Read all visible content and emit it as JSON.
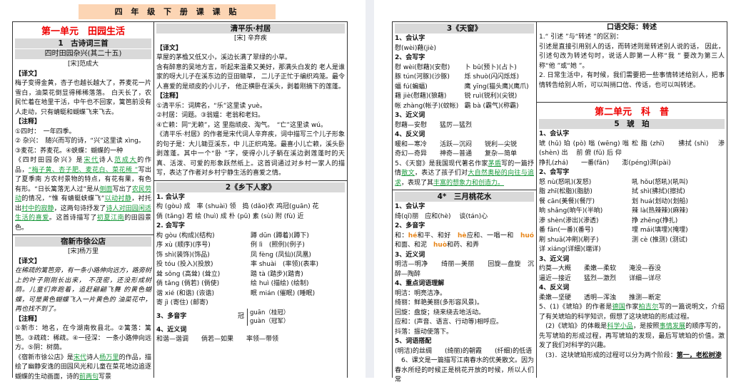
{
  "title": "四 年 级 下 册 课 课 贴",
  "pages": [
    {
      "cols": [
        {
          "cells": [
            {
              "items": [
                {
                  "type": "unit",
                  "text": "第一单元　田园生活"
                },
                {
                  "type": "hdr",
                  "text": "1　古诗词三首"
                },
                {
                  "type": "hdr2",
                  "text": "四时田园杂兴(其二十五)"
                },
                {
                  "type": "author",
                  "text": "[宋]范成大"
                },
                {
                  "type": "h",
                  "text": "【译文】"
                },
                {
                  "type": "p",
                  "text": "梅子变得金黄，杏子也越长越大了，荞麦花一片雪白，油菜花倒显得稀稀落落。 白天长了，农民忙着在地里干活，中午也不回家，篱笆前没有人走动，只有蜻蜓和蝴蝶飞来飞去。"
                },
                {
                  "type": "h",
                  "text": "【注释】"
                },
                {
                  "type": "p",
                  "text": "①四时：　一年四季。"
                },
                {
                  "type": "p",
                  "text": "② 杂兴：　随兴而写的诗，“兴”这里读 xìng。"
                },
                {
                  "type": "p",
                  "text": "③麦花：荞麦花。④蛱蝶：蝴蝶的一种"
                },
                {
                  "type": "p",
                  "segs": [
                    {
                      "t": "《四时田园杂兴》是"
                    },
                    {
                      "t": "宋代",
                      "c": "g"
                    },
                    {
                      "t": "诗人"
                    },
                    {
                      "t": "范成大",
                      "c": "g"
                    },
                    {
                      "t": "的作品，"
                    },
                    {
                      "t": "“梅子黄、杏子肥、麦花白、菜花稀 ”",
                      "c": "g"
                    },
                    {
                      "t": "写出了夏季南 方农村景物的特点，有花有果，有色有形。“日长篱落无人过”是从"
                    },
                    {
                      "t": "侧面",
                      "c": "g"
                    },
                    {
                      "t": "写出了"
                    },
                    {
                      "t": "农民劳动",
                      "c": "g"
                    },
                    {
                      "t": "的情况，“惟 有蜻蜓蛱蝶飞”"
                    },
                    {
                      "t": "以动衬静",
                      "c": "g"
                    },
                    {
                      "t": "，衬托出"
                    },
                    {
                      "t": "村中的寂静",
                      "c": "g"
                    },
                    {
                      "t": "，这两句诗抒发了"
                    },
                    {
                      "t": "诗人对田园闲适生活的喜爱",
                      "c": "g"
                    },
                    {
                      "t": "。这首诗描写了"
                    },
                    {
                      "t": "初夏江南",
                      "c": "g"
                    },
                    {
                      "t": "的田园景色。"
                    }
                  ]
                }
              ]
            },
            {
              "items": [
                {
                  "type": "hdr",
                  "text": "宿新市徐公店"
                },
                {
                  "type": "author",
                  "text": "[宋]杨万里"
                },
                {
                  "type": "h",
                  "text": "【译文】"
                },
                {
                  "type": "pi",
                  "text": "在稀疏的篱笆旁，有一条小路伸向远方，路旁树上的叶子刚刚长出来， 不茂密，还没形成树荫。儿童们奔跑着，追赶翩翩飞舞 的黄色蝴蝶，可是黄色蝴蝶飞入一片黄色的 油菜花中，再也找不到了。"
                },
                {
                  "type": "h",
                  "text": "【注释】"
                },
                {
                  "type": "p",
                  "text": "①新市：地名，在今湖南攸县北。②篱落：篱笆。③疏疏：稀疏。④一径深： 一条小路伸向远方。⑤阴：树荫。"
                },
                {
                  "type": "p",
                  "segs": [
                    {
                      "t": "《宿新市徐公店》是"
                    },
                    {
                      "t": "宋代",
                      "c": "g"
                    },
                    {
                      "t": "诗人"
                    },
                    {
                      "t": "杨万里",
                      "c": "g"
                    },
                    {
                      "t": "的作品，描绘了幽静安逸的田园风光和儿童在菜花地边追逐蝴蝶的生动画面，诗的"
                    },
                    {
                      "t": "前两句",
                      "c": "g"
                    },
                    {
                      "t": "写景"
                    }
                  ]
                }
              ]
            }
          ]
        },
        {
          "cells": [
            {
              "items": [
                {
                  "type": "hdr",
                  "text": "清平乐·村居"
                },
                {
                  "type": "author",
                  "text": "[宋] 辛弃疾"
                },
                {
                  "type": "h",
                  "text": "【译文】"
                },
                {
                  "type": "p",
                  "text": "草屋的茅檐又低又小，溪边长满了翠绿的小草。"
                },
                {
                  "type": "p",
                  "text": "含有醉意的吴地方言，听起来温柔又美好，那满头白发的 老人是谁家的呀大儿子在溪东边的豆田锄草， 二儿子正忙于编织鸡笼。最令人喜爱的是顽皮的小儿子， 他正横卧在溪头，剥着刚摘下的莲蓬。"
                },
                {
                  "type": "h",
                  "text": "【注释】"
                },
                {
                  "type": "p",
                  "text": "①清平乐：词牌名，“乐”这里读 yuè。"
                },
                {
                  "type": "p",
                  "text": "②村居：词题。③翁媪：老翁和老妇。"
                },
                {
                  "type": "p",
                  "text": "④亡赖：同“无赖”，这 里指顽皮、淘气。　“亡”这里读 wú。"
                },
                {
                  "type": "p",
                  "text": "《清平乐·村居》的作者是宋代词人辛弃疾，词中描写三个儿子形象的句子是：大儿锄豆溪东，中 儿正织鸡笼。最喜小儿亡赖，溪头卧剥莲蓬。其中一个“卧 ”字，使得小儿子躺在溪边剥莲蓬时的天 真、活泼、可爱的形象跃然纸上。这首词通过对乡村一家人的描写，表达了作者对乡村宁静生活的喜爱之情。"
                }
              ]
            },
            {
              "items": [
                {
                  "type": "hdr",
                  "text": "2《乡下人家》"
                },
                {
                  "type": "h",
                  "text": "1. 会认字"
                },
                {
                  "type": "p",
                  "text": "构 (gòu) 成　率 (shuài) 领　捣 (dǎo)衣 鸡冠(guān) 花"
                },
                {
                  "type": "p",
                  "text": "倘 (tǎng) 若 绘 (huì) 成 朴 (pǔ) 素 (sù) 附 (fù) 近"
                },
                {
                  "type": "h",
                  "text": "2. 会写字"
                },
                {
                  "type": "row",
                  "cells": [
                    "构 gòu (构成)(结构)",
                    "蹲 dūn (蹲着)(蹲下)"
                  ]
                },
                {
                  "type": "row",
                  "cells": [
                    "序 xù (顺序)(序号)",
                    "例 lì　(照例)(例子)"
                  ]
                },
                {
                  "type": "row",
                  "cells": [
                    "饰 shì(装饰)(饰品)",
                    "凤 fèng (凤仙)(凤凰)"
                  ]
                },
                {
                  "type": "row",
                  "cells": [
                    "投 tóu (投入)(投放)",
                    "率 shuài　(率领)(表率)"
                  ]
                },
                {
                  "type": "row",
                  "cells": [
                    "耸 sǒng (高耸) (耸立)",
                    "踏 tà (踏步)(踏青)"
                  ]
                },
                {
                  "type": "row",
                  "cells": [
                    "倘 tǎng (倘若) (倘使)",
                    "绘 huì (描绘) (绘制)"
                  ]
                },
                {
                  "type": "row",
                  "cells": [
                    "谐 xié (和谐) (诙谐)",
                    "眠 mián (催眠) (睡眠)"
                  ]
                },
                {
                  "type": "row",
                  "cells": [
                    "寄 jì (寄住) (邮寄)",
                    ""
                  ]
                },
                {
                  "type": "poly",
                  "label": "3、多音字",
                  "char": "冠",
                  "r1": "guān（桂冠）",
                  "r2": "guàn（冠军）"
                },
                {
                  "type": "h",
                  "text": "4、近义词"
                },
                {
                  "type": "p",
                  "text": "和谐—谐调　　倘若—如果　　率领—带领"
                }
              ]
            }
          ]
        }
      ]
    },
    {
      "cols": [
        {
          "cells": [
            {
              "items": [
                {
                  "type": "hdr",
                  "text": "3《天窗》"
                },
                {
                  "type": "h",
                  "text": "1、会认字"
                },
                {
                  "type": "p",
                  "text": "慰(wèi)藉(jiè)"
                },
                {
                  "type": "h",
                  "text": "2、会写字"
                },
                {
                  "type": "row",
                  "cells": [
                    "慰 wèi(慰藉)(安慰)",
                    "卜 bǔ(预卜)(占卜)"
                  ]
                },
                {
                  "type": "row",
                  "cells": [
                    "豚 tún(河豚)(沙豚)",
                    "烁 shuò(闪闪烁烁)"
                  ]
                },
                {
                  "type": "row",
                  "cells": [
                    "蝠 fú(蝙蝠)",
                    "鹰 yīng(猫头鹰)(鹰爪)"
                  ]
                },
                {
                  "type": "row",
                  "cells": [
                    "藉 jiè(慰藉)(狼藉)",
                    "锐 ruì(锐利)(尖锐)"
                  ]
                },
                {
                  "type": "row",
                  "cells": [
                    "帐 zhàng(帐子)(蚊帐)",
                    "霸 bà (霸气)(称霸)"
                  ]
                },
                {
                  "type": "h",
                  "text": "3、近义词"
                },
                {
                  "type": "p",
                  "text": "慰藉—安慰　　猛厉—猛烈"
                },
                {
                  "type": "h",
                  "text": "4、反义词"
                },
                {
                  "type": "p",
                  "text": "暖和—寒冷　　活跃—沉闷　　锐利—尖锐"
                },
                {
                  "type": "p",
                  "text": "奇幻—奇异　　神奇—普通　　复杂—简单"
                },
                {
                  "type": "p",
                  "segs": [
                    {
                      "t": "5、《天窗》是我国现代著名作家"
                    },
                    {
                      "t": "茅盾",
                      "c": "g"
                    },
                    {
                      "t": "写的一篇抒情"
                    },
                    {
                      "t": "散文",
                      "c": "g"
                    },
                    {
                      "t": "，表达了孩子们对"
                    },
                    {
                      "t": "大自然奥秘的向往与追求",
                      "c": "g"
                    },
                    {
                      "t": "，表现了其"
                    },
                    {
                      "t": "丰富的想象力和创造力。",
                      "c": "g"
                    }
                  ]
                }
              ]
            },
            {
              "items": [
                {
                  "type": "hdr",
                  "text": "4*　三月桃花水"
                },
                {
                  "type": "h",
                  "text": "1、会认字"
                },
                {
                  "type": "p",
                  "text": "绮(qǐ)丽　应和(hè)　 谈(tán)心"
                },
                {
                  "type": "h",
                  "text": "2、多音字"
                },
                {
                  "type": "p",
                  "segs": [
                    {
                      "t": "和："
                    },
                    {
                      "t": "hé",
                      "c": "o"
                    },
                    {
                      "t": "和平、和好　"
                    },
                    {
                      "t": "hè",
                      "c": "o"
                    },
                    {
                      "t": "应和、一唱一和　"
                    },
                    {
                      "t": "huó",
                      "c": "o"
                    },
                    {
                      "t": "和面、和泥　"
                    },
                    {
                      "t": "huò",
                      "c": "o"
                    },
                    {
                      "t": "和药、和弄"
                    }
                  ]
                },
                {
                  "type": "h",
                  "text": "3、近义词"
                },
                {
                  "type": "p",
                  "text": "明洁—明净　　绮丽—美丽　　回旋—盘旋　沉醉—陶醉"
                },
                {
                  "type": "h",
                  "text": "4、重点词语理解"
                },
                {
                  "type": "p",
                  "text": "明洁：明亮洁净。"
                },
                {
                  "type": "p",
                  "text": "绮丽：鲜艳美丽(多形容风景)。"
                },
                {
                  "type": "p",
                  "text": "回旋：盘旋；绕来绕去地活动。"
                },
                {
                  "type": "p",
                  "text": "应和：(声音、语言、行动等)相呼应。"
                },
                {
                  "type": "p",
                  "text": "抖落：振动使落下。"
                },
                {
                  "type": "h",
                  "text": "5、词语搭配"
                },
                {
                  "type": "p",
                  "text": "(明洁)的丝绸　　(绮丽)的朝霞　　(纤细)的低语"
                },
                {
                  "type": "p",
                  "text": "　6、课文是一篇描写江南春水的优美散文。因为春水所经的时候正是桃花开放的时候，所以人们常"
                }
              ]
            }
          ]
        },
        {
          "cells": [
            {
              "items": [
                {
                  "type": "plain",
                  "text": "口语交际：转述"
                },
                {
                  "type": "p",
                  "text": "1.“ 引述 ”与“转述 ”的区别："
                },
                {
                  "type": "p",
                  "text": "引述是直接引用别人的话，而转述则是转述别人说的话， 因此，引述句改为转述句时，说话人即第一人称“我 ” 要改为第三人称“他 ”或“她 ”。"
                },
                {
                  "type": "p",
                  "text": "2. 日常生活中，有时候，我们需要把一些事情转述给别人，把事情转告给别人听，可以叫捎口信、传话，也可以叫转述。"
                }
              ]
            },
            {
              "items": [
                {
                  "type": "unit",
                  "text": "第二单元　科　普"
                },
                {
                  "type": "hdr",
                  "text": "5　琥　珀"
                },
                {
                  "type": "h",
                  "text": "1、会认字"
                },
                {
                  "type": "p",
                  "text": "琥 (hǔ) 珀 (pò) 嗡 (wēng) 嗡 松 脂 (zhī)　　拂拭 (shì)　 渗 (shèn) 出　 前 俯 (fǔ) 后 仰"
                },
                {
                  "type": "p",
                  "text": "挣扎(zhá)　　一番(fān)　　澎(péng)湃(pài)"
                },
                {
                  "type": "h",
                  "text": "2、会写字"
                },
                {
                  "type": "row",
                  "cells": [
                    "怒 nù(怒吼)(发怒)",
                    "吼 hǒu(怒吼)(吼叫)"
                  ]
                },
                {
                  "type": "row",
                  "cells": [
                    "脂 zhī(松脂)(脂肪)",
                    "拭 shì(拂拭)(擦拭)"
                  ]
                },
                {
                  "type": "row",
                  "cells": [
                    "餐 cān(美餐)(餐厅)",
                    "划 huá(划动)(划船)"
                  ]
                },
                {
                  "type": "row",
                  "cells": [
                    "晌 shǎng(晌午)(半晌)",
                    "辣 là(热辣辣)(麻辣)"
                  ]
                },
                {
                  "type": "row",
                  "cells": [
                    "渗 shèn(渗出)(渗透)",
                    "挣 zhēng(挣扎)"
                  ]
                },
                {
                  "type": "row",
                  "cells": [
                    "番 fān(一番)(番号)",
                    "埋 mái(填埋)(掩埋)"
                  ]
                },
                {
                  "type": "row",
                  "cells": [
                    "刷 shuā(冲刷)(刷子)",
                    "测 cè (推测) (测试)"
                  ]
                },
                {
                  "type": "row",
                  "cells": [
                    "详 xiáng(详细)(端详)",
                    ""
                  ]
                },
                {
                  "type": "h",
                  "text": "3、近义词"
                },
                {
                  "type": "p",
                  "text": "约莫—大概　　柔嫩—柔软　　淹没—吞没"
                },
                {
                  "type": "p",
                  "text": "逼近—接近　　猛烈—激烈　　详细—详尽"
                },
                {
                  "type": "h",
                  "text": "4、反义词"
                },
                {
                  "type": "p",
                  "text": "柔嫩—坚硬　　透明—浑浊　　推测—断定"
                },
                {
                  "type": "p",
                  "segs": [
                    {
                      "t": "5、(1)《琥珀》的作者是"
                    },
                    {
                      "t": "德国",
                      "c": "g"
                    },
                    {
                      "t": "作家"
                    },
                    {
                      "t": "柏吉尔",
                      "c": "g"
                    },
                    {
                      "t": "写的一篇说明文，介绍了有关琥珀的科学知识，假想了这块琥珀的形成过程。"
                    }
                  ]
                },
                {
                  "type": "p",
                  "segs": [
                    {
                      "t": "　(2)《琥珀》的体裁是"
                    },
                    {
                      "t": "科学小品",
                      "c": "g"
                    },
                    {
                      "t": "，是按照"
                    },
                    {
                      "t": "事情发展",
                      "c": "g"
                    },
                    {
                      "t": "的顺序写的，先写琥珀的形成过程，再写琥珀的发现，最后写琥珀的价值。激发了我们对科学的兴趣。"
                    }
                  ]
                },
                {
                  "type": "p",
                  "segs": [
                    {
                      "t": "　(3)．这块琥珀形成的过程可以分为两个阶段："
                    },
                    {
                      "t": "第一，老松树渗",
                      "c": "u"
                    }
                  ]
                }
              ]
            }
          ]
        }
      ]
    }
  ]
}
